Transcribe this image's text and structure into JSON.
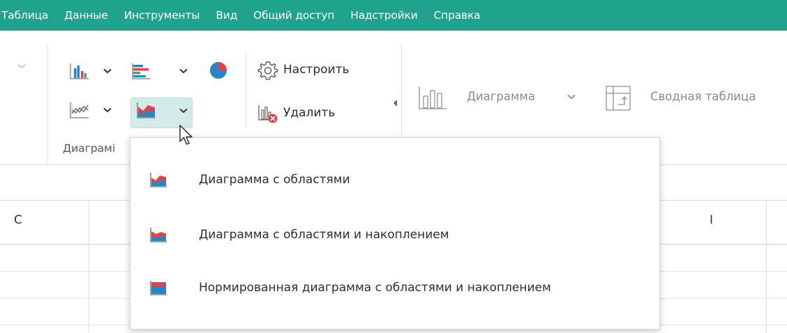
{
  "menu": {
    "items": [
      "Таблица",
      "Данные",
      "Инструменты",
      "Вид",
      "Общий доступ",
      "Надстройки",
      "Справка"
    ]
  },
  "ribbon": {
    "configure_label": "Настроить",
    "delete_label": "Удалить",
    "chart_label": "Диаграмма",
    "pivot_label": "Сводная таблица",
    "group_label": "Диаграмі"
  },
  "sheet": {
    "column_c": "C",
    "column_i": "I"
  },
  "dropdown": {
    "items": [
      {
        "label": "Диаграмма с областями",
        "icon": "area-chart-icon"
      },
      {
        "label": "Диаграмма с областями и накоплением",
        "icon": "stacked-area-chart-icon"
      },
      {
        "label": "Нормированная диаграмма с областями и накоплением",
        "icon": "percent-stacked-area-chart-icon"
      }
    ]
  },
  "colors": {
    "menubar": "#20a38d",
    "accent_red": "#e2434b",
    "accent_blue": "#1e88c8",
    "accent_green": "#3fae5a",
    "hover": "#d3ecea"
  }
}
